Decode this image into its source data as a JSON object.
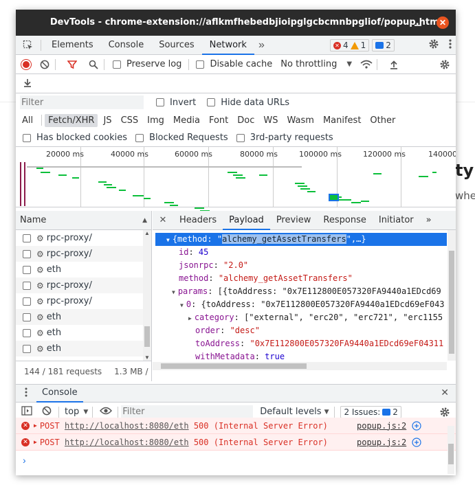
{
  "background": {
    "heading_fragment": "ty",
    "sub_fragment": "whe"
  },
  "window": {
    "title": "DevTools - chrome-extension://aflkmfhebedbjioipglgcbcmnbpgliof/popup.html",
    "minimize_glyph": "–",
    "close_glyph": "✕"
  },
  "tabs": [
    "Elements",
    "Console",
    "Sources",
    "Network"
  ],
  "more_tabs": "»",
  "badges": {
    "errors": "4",
    "warnings": "1",
    "messages": "2"
  },
  "toolbar": {
    "preserve_log": "Preserve log",
    "disable_cache": "Disable cache",
    "throttling": "No throttling"
  },
  "filter": {
    "placeholder": "Filter",
    "invert": "Invert",
    "hide_data_urls": "Hide data URLs"
  },
  "types": [
    "All",
    "Fetch/XHR",
    "JS",
    "CSS",
    "Img",
    "Media",
    "Font",
    "Doc",
    "WS",
    "Wasm",
    "Manifest",
    "Other"
  ],
  "blocked": {
    "has_blocked_cookies": "Has blocked cookies",
    "blocked_requests": "Blocked Requests",
    "third_party": "3rd-party requests"
  },
  "overview": {
    "ticks": [
      "20000 ms",
      "40000 ms",
      "60000 ms",
      "80000 ms",
      "100000 ms",
      "120000 ms",
      "140000"
    ]
  },
  "requests": {
    "header": "Name",
    "rows": [
      "rpc-proxy/",
      "rpc-proxy/",
      "eth",
      "rpc-proxy/",
      "rpc-proxy/",
      "eth",
      "eth",
      "eth"
    ],
    "count": "144 / 181 requests",
    "size": "1.3 MB /"
  },
  "detail": {
    "close": "✕",
    "tabs": [
      "Headers",
      "Payload",
      "Preview",
      "Response",
      "Initiator"
    ],
    "more": "»",
    "payload": {
      "root_prefix": "{method: \"",
      "root_method": "alchemy_getAssetTransfers",
      "root_suffix": "\",…}",
      "id_key": "id",
      "id_val": "45",
      "jsonrpc_key": "jsonrpc",
      "jsonrpc_val": "\"2.0\"",
      "method_key": "method",
      "method_val": "\"alchemy_getAssetTransfers\"",
      "params_key": "params",
      "params_val": "[{toAddress: \"0x7E112800E057320FA9440a1EDcd69",
      "item0_key": "0",
      "item0_val": "{toAddress: \"0x7E112800E057320FA9440a1EDcd69eF043",
      "category_key": "category",
      "category_val": "[\"external\", \"erc20\", \"erc721\", \"erc1155",
      "order_key": "order",
      "order_val": "\"desc\"",
      "to_key": "toAddress",
      "to_val": "\"0x7E112800E057320FA9440a1EDcd69eF04311",
      "meta_key": "withMetadata",
      "meta_val": "true"
    }
  },
  "console": {
    "title": "Console",
    "context": "top",
    "filter_placeholder": "Filter",
    "levels": "Default levels",
    "issues_label": "2 Issues:",
    "issues_count": "2",
    "rows": [
      {
        "method": "POST",
        "url": "http://localhost:8080/eth",
        "status": "500 (Internal Server Error)",
        "source": "popup.js:2"
      },
      {
        "method": "POST",
        "url": "http://localhost:8080/eth",
        "status": "500 (Internal Server Error)",
        "source": "popup.js:2"
      }
    ],
    "prompt": "›"
  },
  "colors": {
    "accent": "#1a73e8",
    "error": "#d93025",
    "warning": "#f29900",
    "titlebar": "#2b2b2b",
    "close_button": "#e95420",
    "waterfall_green": "#0bbf3a"
  }
}
